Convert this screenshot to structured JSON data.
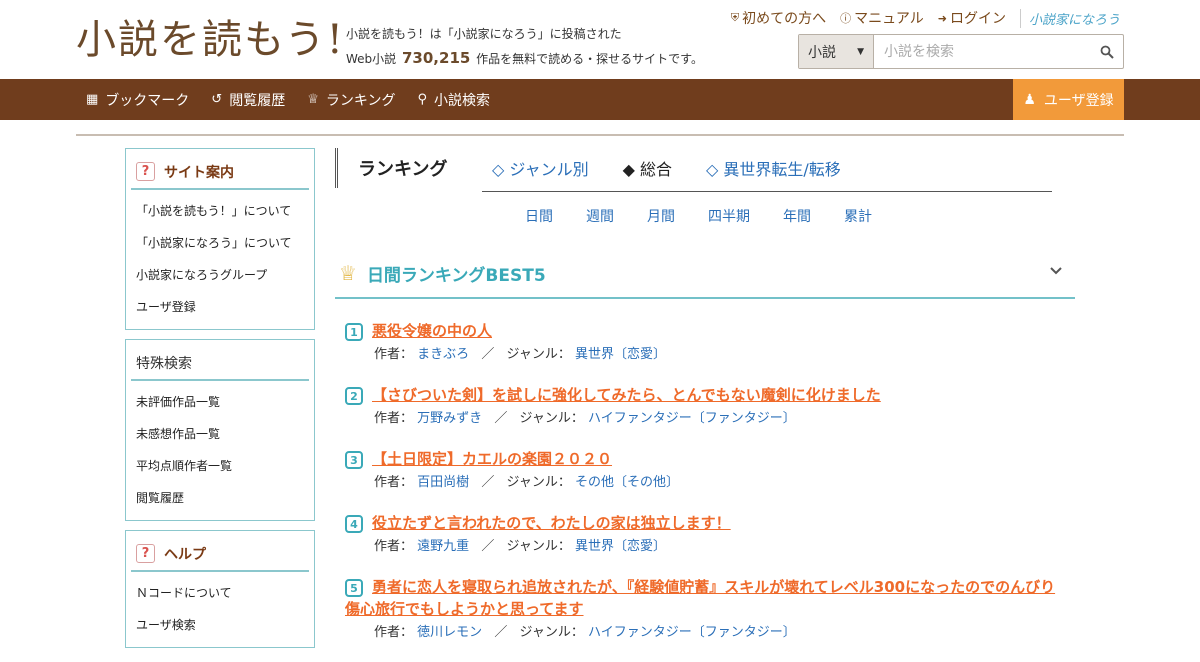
{
  "header": {
    "logo": "小説を読もう!",
    "tagline_line1": "小説を読もう！は「小説家になろう」に投稿された",
    "tagline_prefix": "Web小説",
    "work_count": "730,215",
    "tagline_suffix": "作品を無料で読める・探せるサイトです。",
    "links": [
      {
        "label": "初めての方へ",
        "icon": "shield-icon"
      },
      {
        "label": "マニュアル",
        "icon": "help-icon"
      },
      {
        "label": "ログイン",
        "icon": "login-icon"
      }
    ],
    "brand": "小説家になろう",
    "search": {
      "category": "小説",
      "placeholder": "小説を検索"
    }
  },
  "nav": {
    "items": [
      {
        "label": "ブックマーク",
        "icon": "bookmark-icon"
      },
      {
        "label": "閲覧履歴",
        "icon": "history-icon"
      },
      {
        "label": "ランキング",
        "icon": "crown-icon"
      },
      {
        "label": "小説検索",
        "icon": "search-icon"
      }
    ],
    "register": "ユーザ登録"
  },
  "sidebar": {
    "site_guide": {
      "title": "サイト案内",
      "items": [
        "「小説を読もう！」について",
        "「小説家になろう」について",
        "小説家になろうグループ",
        "ユーザ登録"
      ]
    },
    "special_search": {
      "title": "特殊検索",
      "items": [
        "未評価作品一覧",
        "未感想作品一覧",
        "平均点順作者一覧",
        "閲覧履歴"
      ]
    },
    "help": {
      "title": "ヘルプ",
      "items": [
        "Ｎコードについて",
        "ユーザ検索"
      ]
    }
  },
  "main": {
    "ranking_title": "ランキング",
    "tabs": [
      "◇ ジャンル別",
      "◆ 総合",
      "◇ 異世界転生/転移"
    ],
    "periods": [
      "日間",
      "週間",
      "月間",
      "四半期",
      "年間",
      "累計"
    ],
    "best5_title": "日間ランキングBEST5",
    "author_label": "作者：",
    "genre_label": "ジャンル：",
    "separator": "／",
    "rankings": [
      {
        "rank": "1",
        "title": "悪役令嬢の中の人",
        "author": "まきぶろ",
        "genre": "異世界〔恋愛〕"
      },
      {
        "rank": "2",
        "title": "【さびついた剣】を試しに強化してみたら、とんでもない魔剣に化けました",
        "author": "万野みずき",
        "genre": "ハイファンタジー〔ファンタジー〕"
      },
      {
        "rank": "3",
        "title": "【土日限定】カエルの楽園２０２０",
        "author": "百田尚樹",
        "genre": "その他〔その他〕"
      },
      {
        "rank": "4",
        "title": "役立たずと言われたので、わたしの家は独立します！",
        "author": "遠野九重",
        "genre": "異世界〔恋愛〕"
      },
      {
        "rank": "5",
        "title": "勇者に恋人を寝取られ追放されたが、『経験値貯蓄』スキルが壊れてレベル300になったのでのんびり傷心旅行でもしようかと思ってます",
        "author": "徳川レモン",
        "genre": "ハイファンタジー〔ファンタジー〕"
      }
    ]
  }
}
